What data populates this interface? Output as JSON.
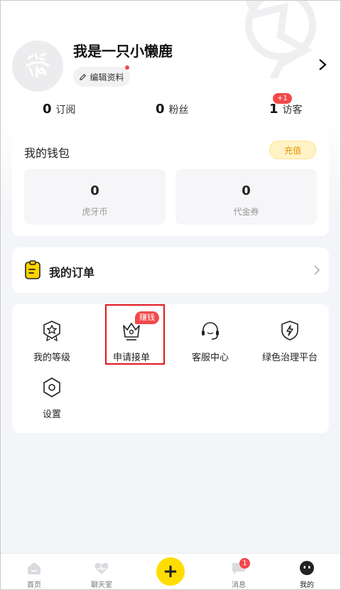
{
  "profile": {
    "nickname": "我是一只小懒鹿",
    "edit_label": "编辑资料"
  },
  "stats": [
    {
      "count": "0",
      "label": "订阅"
    },
    {
      "count": "0",
      "label": "粉丝"
    },
    {
      "count": "1",
      "label": "访客",
      "badge": "+1"
    }
  ],
  "wallet": {
    "title": "我的钱包",
    "recharge_label": "充值",
    "items": [
      {
        "value": "0",
        "label": "虎牙币"
      },
      {
        "value": "0",
        "label": "代金券"
      }
    ]
  },
  "orders": {
    "title": "我的订单"
  },
  "services": {
    "items": [
      {
        "label": "我的等级",
        "icon": "level-badge-icon"
      },
      {
        "label": "申请接单",
        "icon": "crown-icon",
        "badge": "赚钱"
      },
      {
        "label": "客服中心",
        "icon": "headset-icon"
      },
      {
        "label": "绿色治理平台",
        "icon": "shield-lightning-icon"
      },
      {
        "label": "设置",
        "icon": "hexagon-settings-icon"
      }
    ]
  },
  "bottom_nav": {
    "items": [
      {
        "label": "首页",
        "icon": "home-icon"
      },
      {
        "label": "聊天室",
        "icon": "heart-chat-icon"
      },
      {
        "label": "",
        "icon": "plus-icon"
      },
      {
        "label": "消息",
        "icon": "message-icon",
        "badge": "1"
      },
      {
        "label": "我的",
        "icon": "profile-face-icon"
      }
    ],
    "add_symbol": "+"
  },
  "colors": {
    "accent_yellow": "#ffdd00",
    "badge_red": "#f2484a",
    "highlight_red": "#e0191f",
    "recharge_text": "#e29300"
  }
}
